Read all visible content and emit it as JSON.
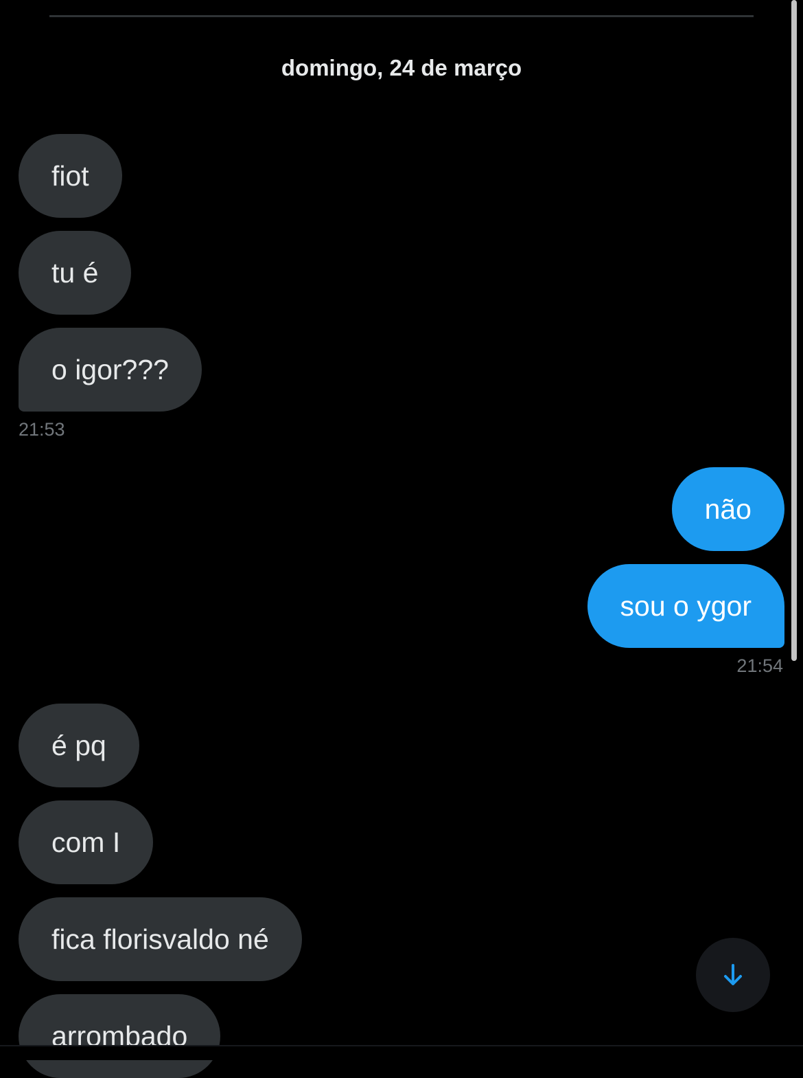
{
  "conversation": {
    "date_header": "domingo, 24 de março",
    "groups": [
      {
        "direction": "incoming",
        "messages": [
          "fiot",
          "tu é",
          "o igor???"
        ],
        "time": "21:53"
      },
      {
        "direction": "outgoing",
        "messages": [
          "não",
          "sou o ygor"
        ],
        "time": "21:54"
      },
      {
        "direction": "incoming",
        "messages": [
          "é pq",
          "com I",
          "fica florisvaldo né",
          "arrombado"
        ]
      }
    ]
  },
  "controls": {
    "scroll_down_icon": "arrow-down-icon"
  },
  "colors": {
    "background": "#000000",
    "incoming_bubble": "#2f3336",
    "outgoing_bubble": "#1d9bf0",
    "timestamp_text": "#71767b",
    "scroll_button_icon": "#1d9bf0"
  }
}
